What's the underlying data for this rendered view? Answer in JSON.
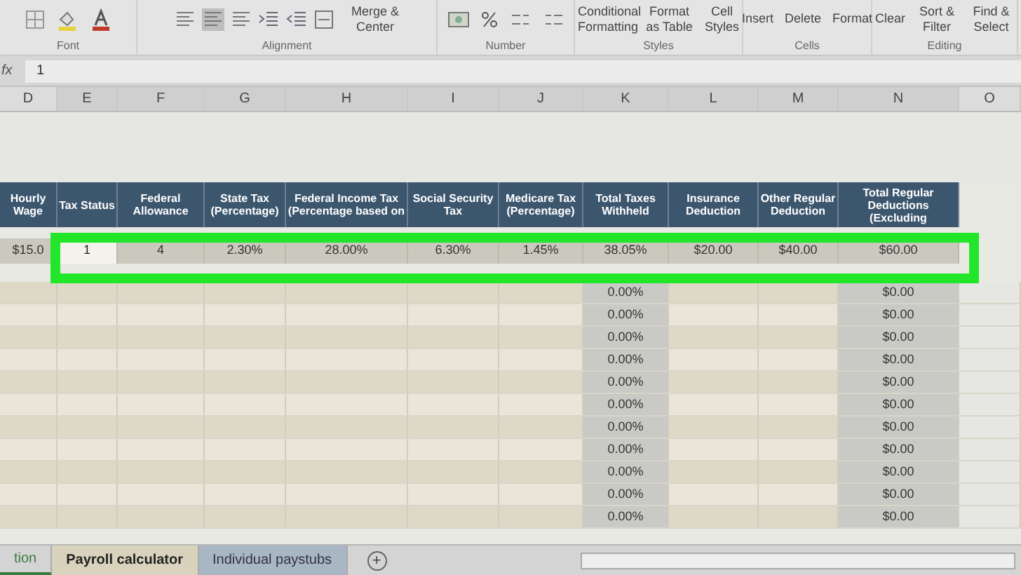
{
  "ribbon": {
    "groups": [
      {
        "label": "Font"
      },
      {
        "label": "Alignment",
        "buttons": [
          "Merge & Center"
        ]
      },
      {
        "label": "Number"
      },
      {
        "label": "Styles",
        "buttons": [
          "Conditional Formatting",
          "Format as Table",
          "Cell Styles"
        ]
      },
      {
        "label": "Cells",
        "buttons": [
          "Insert",
          "Delete",
          "Format"
        ]
      },
      {
        "label": "Editing",
        "buttons": [
          "Clear",
          "Sort & Filter",
          "Find & Select"
        ]
      }
    ]
  },
  "formula_bar": {
    "fx": "fx",
    "value": "1"
  },
  "columns": [
    "D",
    "E",
    "F",
    "G",
    "H",
    "I",
    "J",
    "K",
    "L",
    "M",
    "N",
    "O"
  ],
  "table": {
    "headers": [
      "Hourly Wage",
      "Tax Status",
      "Federal Allowance",
      "State Tax (Percentage)",
      "Federal Income Tax (Percentage based on",
      "Social Security Tax",
      "Medicare Tax (Percentage)",
      "Total Taxes Withheld",
      "Insurance Deduction",
      "Other Regular Deduction",
      "Total Regular Deductions (Excluding"
    ],
    "data_row": [
      {
        "text": "$15.0",
        "selected": false
      },
      {
        "text": "1",
        "selected": true
      },
      {
        "text": "4",
        "selected": false
      },
      {
        "text": "2.30%",
        "selected": false
      },
      {
        "text": "28.00%",
        "selected": false
      },
      {
        "text": "6.30%",
        "selected": false
      },
      {
        "text": "1.45%",
        "selected": false
      },
      {
        "text": "38.05%",
        "selected": false
      },
      {
        "text": "$20.00",
        "selected": false
      },
      {
        "text": "$40.00",
        "selected": false
      },
      {
        "text": "$60.00",
        "selected": false
      }
    ],
    "rows": [
      {
        "total_taxes": "0.00%",
        "total_deductions": "$0.00"
      },
      {
        "total_taxes": "0.00%",
        "total_deductions": "$0.00"
      },
      {
        "total_taxes": "0.00%",
        "total_deductions": "$0.00"
      },
      {
        "total_taxes": "0.00%",
        "total_deductions": "$0.00"
      },
      {
        "total_taxes": "0.00%",
        "total_deductions": "$0.00"
      },
      {
        "total_taxes": "0.00%",
        "total_deductions": "$0.00"
      },
      {
        "total_taxes": "0.00%",
        "total_deductions": "$0.00"
      },
      {
        "total_taxes": "0.00%",
        "total_deductions": "$0.00"
      },
      {
        "total_taxes": "0.00%",
        "total_deductions": "$0.00"
      },
      {
        "total_taxes": "0.00%",
        "total_deductions": "$0.00"
      },
      {
        "total_taxes": "0.00%",
        "total_deductions": "$0.00"
      }
    ]
  },
  "sheet_tabs": [
    {
      "label": "tion",
      "selected": false,
      "color": "#3a7d44"
    },
    {
      "label": "Payroll calculator",
      "selected": true,
      "color": "#d9d3bd"
    },
    {
      "label": "Individual paystubs",
      "selected": false,
      "color": "#a9b6c4"
    }
  ],
  "add_sheet": "+"
}
